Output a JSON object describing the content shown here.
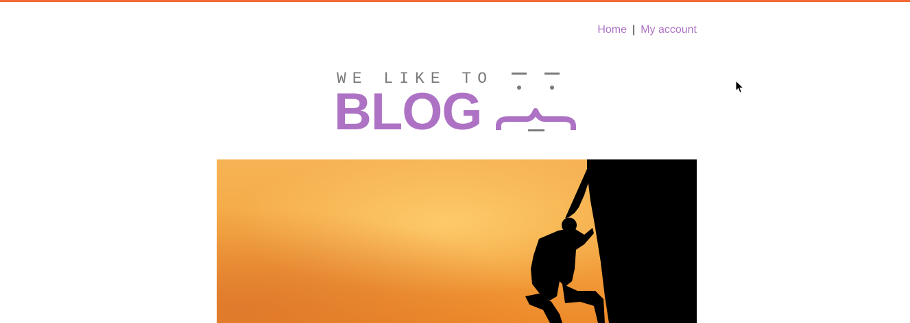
{
  "colors": {
    "top_bar": "#f26a35",
    "link": "#ad72c4",
    "brand_purple": "#ad72c4",
    "logo_gray": "#7a7a7a"
  },
  "nav": {
    "home_label": "Home",
    "separator": "|",
    "account_label": "My account"
  },
  "logo": {
    "tagline": "WE LIKE TO",
    "word": "BLOG"
  },
  "hero": {
    "image": "climber-silhouette-sunset"
  },
  "icons": {
    "cursor": "mouse-pointer-icon"
  }
}
